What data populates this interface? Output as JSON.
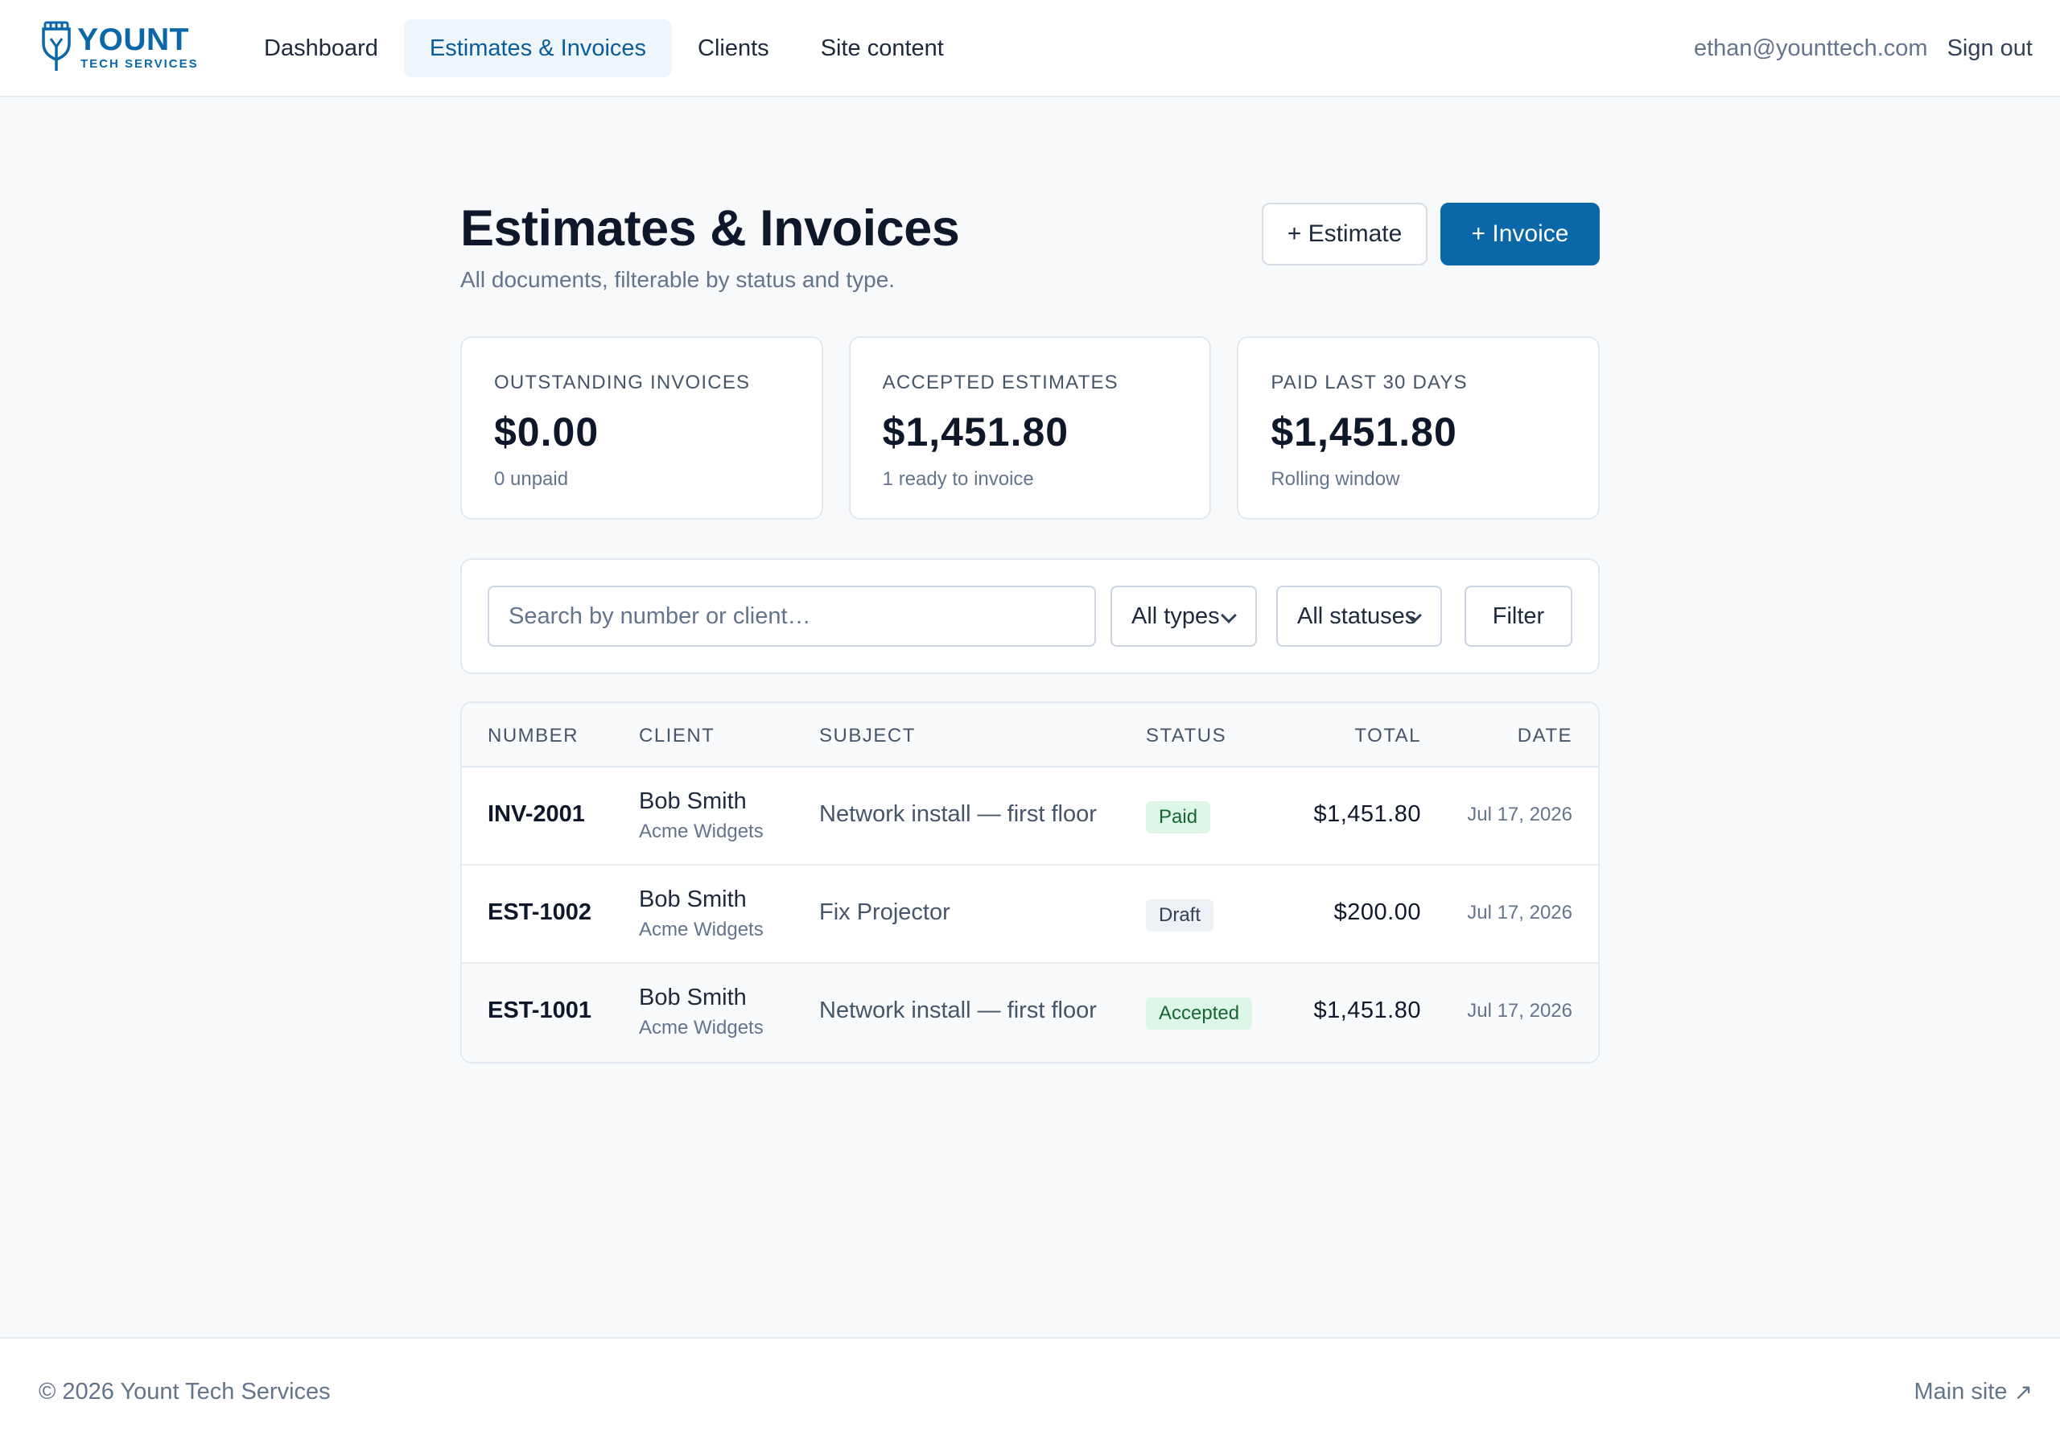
{
  "brand": {
    "name": "YOUNT",
    "tagline": "TECH SERVICES",
    "color": "#0a67a8"
  },
  "nav": {
    "items": [
      {
        "label": "Dashboard",
        "active": false
      },
      {
        "label": "Estimates & Invoices",
        "active": true
      },
      {
        "label": "Clients",
        "active": false
      },
      {
        "label": "Site content",
        "active": false
      }
    ]
  },
  "user": {
    "email": "ethan@younttech.com",
    "signout_label": "Sign out"
  },
  "page": {
    "title": "Estimates & Invoices",
    "subtitle": "All documents, filterable by status and type.",
    "new_estimate_label": "+ Estimate",
    "new_invoice_label": "+ Invoice"
  },
  "stats": [
    {
      "label": "OUTSTANDING INVOICES",
      "value": "$0.00",
      "note": "0 unpaid"
    },
    {
      "label": "ACCEPTED ESTIMATES",
      "value": "$1,451.80",
      "note": "1 ready to invoice"
    },
    {
      "label": "PAID LAST 30 DAYS",
      "value": "$1,451.80",
      "note": "Rolling window"
    }
  ],
  "filters": {
    "search_placeholder": "Search by number or client…",
    "type_select": "All types",
    "status_select": "All statuses",
    "filter_label": "Filter"
  },
  "table": {
    "headers": {
      "number": "NUMBER",
      "client": "CLIENT",
      "subject": "SUBJECT",
      "status": "STATUS",
      "total": "TOTAL",
      "date": "DATE"
    },
    "rows": [
      {
        "number": "INV-2001",
        "client": "Bob Smith",
        "company": "Acme Widgets",
        "subject": "Network install — first floor",
        "status": "Paid",
        "total": "$1,451.80",
        "date": "Jul 17, 2026"
      },
      {
        "number": "EST-1002",
        "client": "Bob Smith",
        "company": "Acme Widgets",
        "subject": "Fix Projector",
        "status": "Draft",
        "total": "$200.00",
        "date": "Jul 17, 2026"
      },
      {
        "number": "EST-1001",
        "client": "Bob Smith",
        "company": "Acme Widgets",
        "subject": "Network install — first floor",
        "status": "Accepted",
        "total": "$1,451.80",
        "date": "Jul 17, 2026"
      }
    ]
  },
  "footer": {
    "copyright": "© 2026 Yount Tech Services",
    "main_site_label": "Main site",
    "main_site_icon": "external-arrow-icon"
  },
  "colors": {
    "accent": "#0a67a8",
    "paid_bg": "#dcf7e7",
    "paid_text": "#166534",
    "draft_bg": "#eef1f5"
  }
}
